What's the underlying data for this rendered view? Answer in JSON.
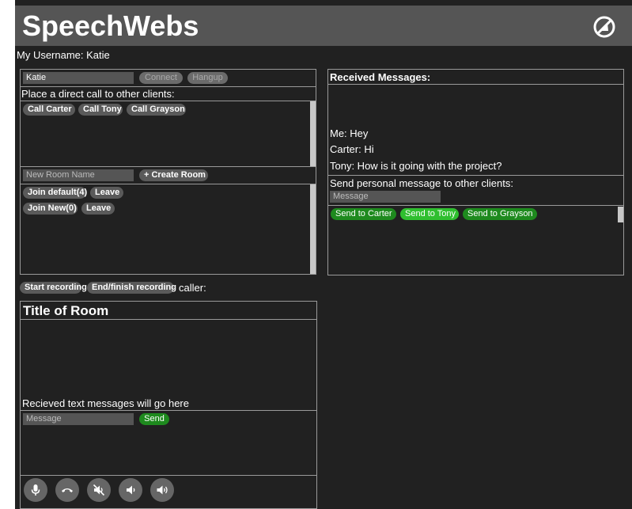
{
  "app": {
    "title": "SpeechWebs",
    "logo_icon": "slashed-circle-logo-icon"
  },
  "user": {
    "label": "My Username: Katie"
  },
  "connection": {
    "name_value": "Katie",
    "connect_label": "Connect",
    "hangup_label": "Hangup"
  },
  "calls": {
    "heading": "Place a direct call to other clients:",
    "buttons": [
      "Call Carter",
      "Call Tony",
      "Call Grayson"
    ]
  },
  "rooms": {
    "name_placeholder": "New Room Name",
    "create_label": "+ Create Room",
    "list": [
      {
        "join": "Join default(4)",
        "leave": "Leave"
      },
      {
        "join": "Join New(0)",
        "leave": "Leave"
      }
    ]
  },
  "received": {
    "heading": "Received Messages:",
    "messages": [
      "Me: Hey",
      "Carter: Hi",
      "Tony: How is it going with the project?"
    ]
  },
  "personal": {
    "heading": "Send personal message to other clients:",
    "placeholder": "Message",
    "send_buttons": [
      "Send to Carter",
      "Send to Tony",
      "Send to Grayson"
    ]
  },
  "recording": {
    "start_label": "Start recording",
    "end_label": "End/finish recording",
    "caller_label": "caller:"
  },
  "room": {
    "title": "Title of Room",
    "placeholder_text": "Recieved text messages will go here",
    "message_placeholder": "Message",
    "send_label": "Send"
  },
  "controls": [
    "microphone-icon",
    "hang-up-icon",
    "mute-speaker-icon",
    "volume-down-icon",
    "volume-up-icon"
  ]
}
